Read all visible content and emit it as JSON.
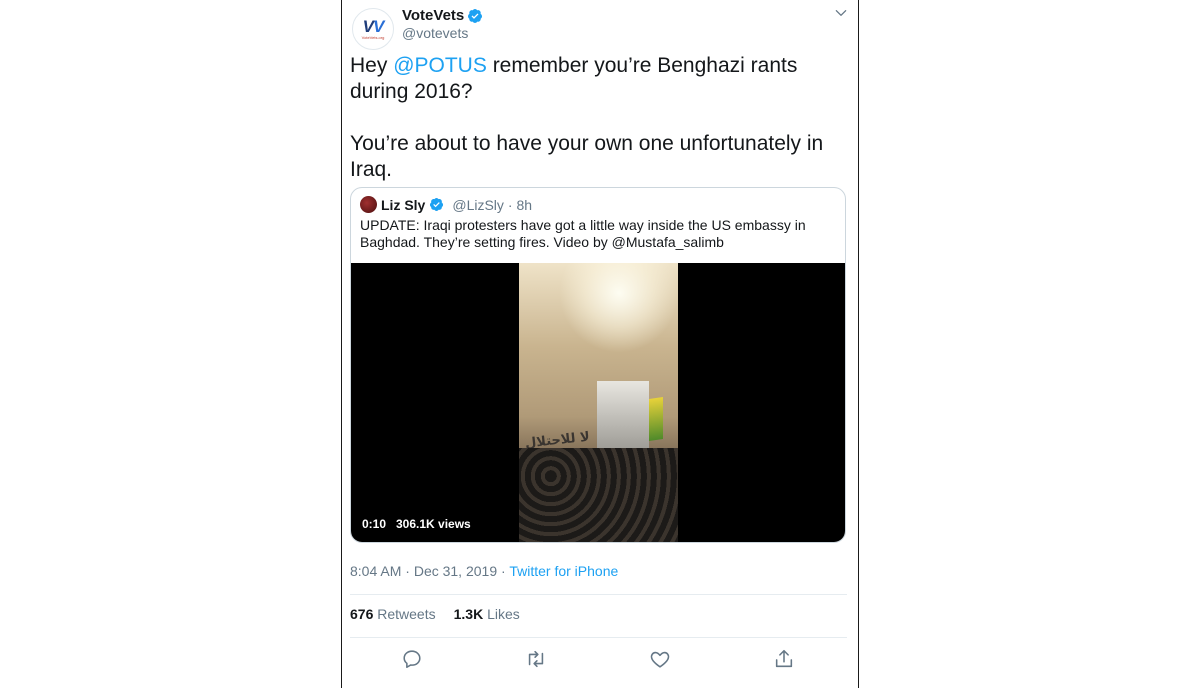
{
  "author": {
    "name": "VoteVets",
    "handle": "@votevets",
    "avatar_logo": "VV",
    "avatar_site": "VoteVets.org",
    "verified_icon": "verified-badge-icon"
  },
  "tweet": {
    "text_part1_pre": "Hey ",
    "text_mention": "@POTUS",
    "text_part1_post": " remember you’re Benghazi rants during 2016?",
    "text_part2": "You’re about to have your own one unfortunately in Iraq."
  },
  "quoted_tweet": {
    "name": "Liz Sly",
    "handle": "@LizSly",
    "age": "· 8h",
    "text": "UPDATE: Iraqi protesters have got a little way inside the US embassy in Baghdad. They’re setting fires. Video by @Mustafa_salimb",
    "video": {
      "duration": "0:10",
      "views": "306.1K views",
      "graffiti": "لا للاحتلال"
    }
  },
  "meta": {
    "time": "8:04 AM",
    "separator": " · ",
    "date": "Dec 31, 2019",
    "separator2": " · ",
    "source": "Twitter for iPhone"
  },
  "stats": {
    "retweets_count": "676",
    "retweets_label": "Retweets",
    "likes_count": "1.3K",
    "likes_label": "Likes"
  },
  "actions": [
    "reply-icon",
    "retweet-icon",
    "like-icon",
    "share-icon"
  ],
  "colors": {
    "accent": "#1da1f2",
    "text": "#14171a",
    "secondary": "#657786"
  }
}
